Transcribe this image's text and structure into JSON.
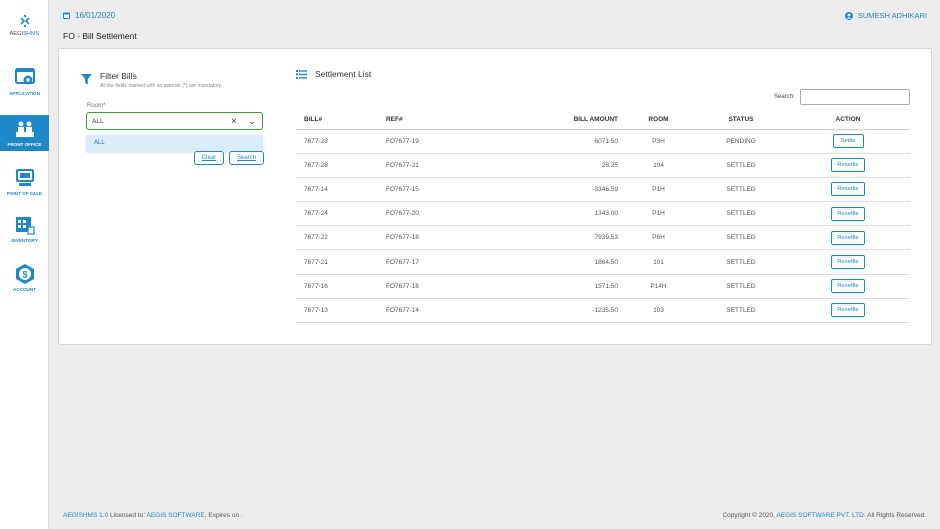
{
  "app": {
    "logo_prefix": "AEGIS",
    "logo_suffix": "HMS"
  },
  "header": {
    "date": "16/01/2020",
    "user": "SUMESH ADHIKARI",
    "page_title": "FO - Bill Settlement"
  },
  "sidebar": {
    "items": [
      {
        "label": "APPLICATION",
        "icon": "application-icon",
        "active": false
      },
      {
        "label": "FRONT OFFICE",
        "icon": "front-office-icon",
        "active": true
      },
      {
        "label": "POINT OF SALE",
        "icon": "point-of-sale-icon",
        "active": false
      },
      {
        "label": "INVENTORY",
        "icon": "inventory-icon",
        "active": false
      },
      {
        "label": "ACCOUNT",
        "icon": "account-icon",
        "active": false
      }
    ]
  },
  "filter": {
    "title": "Filter Bills",
    "subtitle": "All the fields marked with an asterisk (*) are mandatory.",
    "room_label": "Room",
    "room_required": "*",
    "room_value": "ALL",
    "dropdown_option": "ALL",
    "clear_label": "Clear",
    "search_label": "Search"
  },
  "list": {
    "title": "Settlement List",
    "search_label": "Search:",
    "search_value": "",
    "columns": [
      "BILL#",
      "REF#",
      "BILL AMOUNT",
      "ROOM",
      "STATUS",
      "ACTION"
    ],
    "rows": [
      {
        "bill": "7677-23",
        "ref": "FO7677-19",
        "amount": "6071.50",
        "room": "P3H",
        "status": "PENDING",
        "action": "Settle"
      },
      {
        "bill": "7677-28",
        "ref": "FO7677-21",
        "amount": "28.25",
        "room": "104",
        "status": "SETTLED",
        "action": "Resettle"
      },
      {
        "bill": "7677-14",
        "ref": "FO7677-15",
        "amount": "-3346.59",
        "room": "P1H",
        "status": "SETTLED",
        "action": "Resettle"
      },
      {
        "bill": "7677-24",
        "ref": "FO7677-20",
        "amount": "1343.00",
        "room": "P1H",
        "status": "SETTLED",
        "action": "Resettle"
      },
      {
        "bill": "7677-22",
        "ref": "FO7677-18",
        "amount": "7939.53",
        "room": "P6H",
        "status": "SETTLED",
        "action": "Resettle"
      },
      {
        "bill": "7677-21",
        "ref": "FO7677-17",
        "amount": "1864.50",
        "room": "101",
        "status": "SETTLED",
        "action": "Resettle"
      },
      {
        "bill": "7677-16",
        "ref": "FO7677-16",
        "amount": "1571.50",
        "room": "P14H",
        "status": "SETTLED",
        "action": "Resettle"
      },
      {
        "bill": "7677-13",
        "ref": "FO7677-14",
        "amount": "-1235.50",
        "room": "103",
        "status": "SETTLED",
        "action": "Resettle"
      }
    ]
  },
  "footer": {
    "product": "AEGISHMS 1.0",
    "licensed_to_label": "Licensed to:",
    "licensee": "AEGIS SOFTWARE",
    "expires_label": ", Expires on .",
    "copyright_prefix": "Copyright © 2020,",
    "company": "AEGIS SOFTWARE PVT. LTD.",
    "rights": "All Rights Reserved."
  },
  "colors": {
    "accent": "#1e88c8",
    "focus_border": "#3a9d3a",
    "dropdown_highlight": "#d9ecf9"
  }
}
